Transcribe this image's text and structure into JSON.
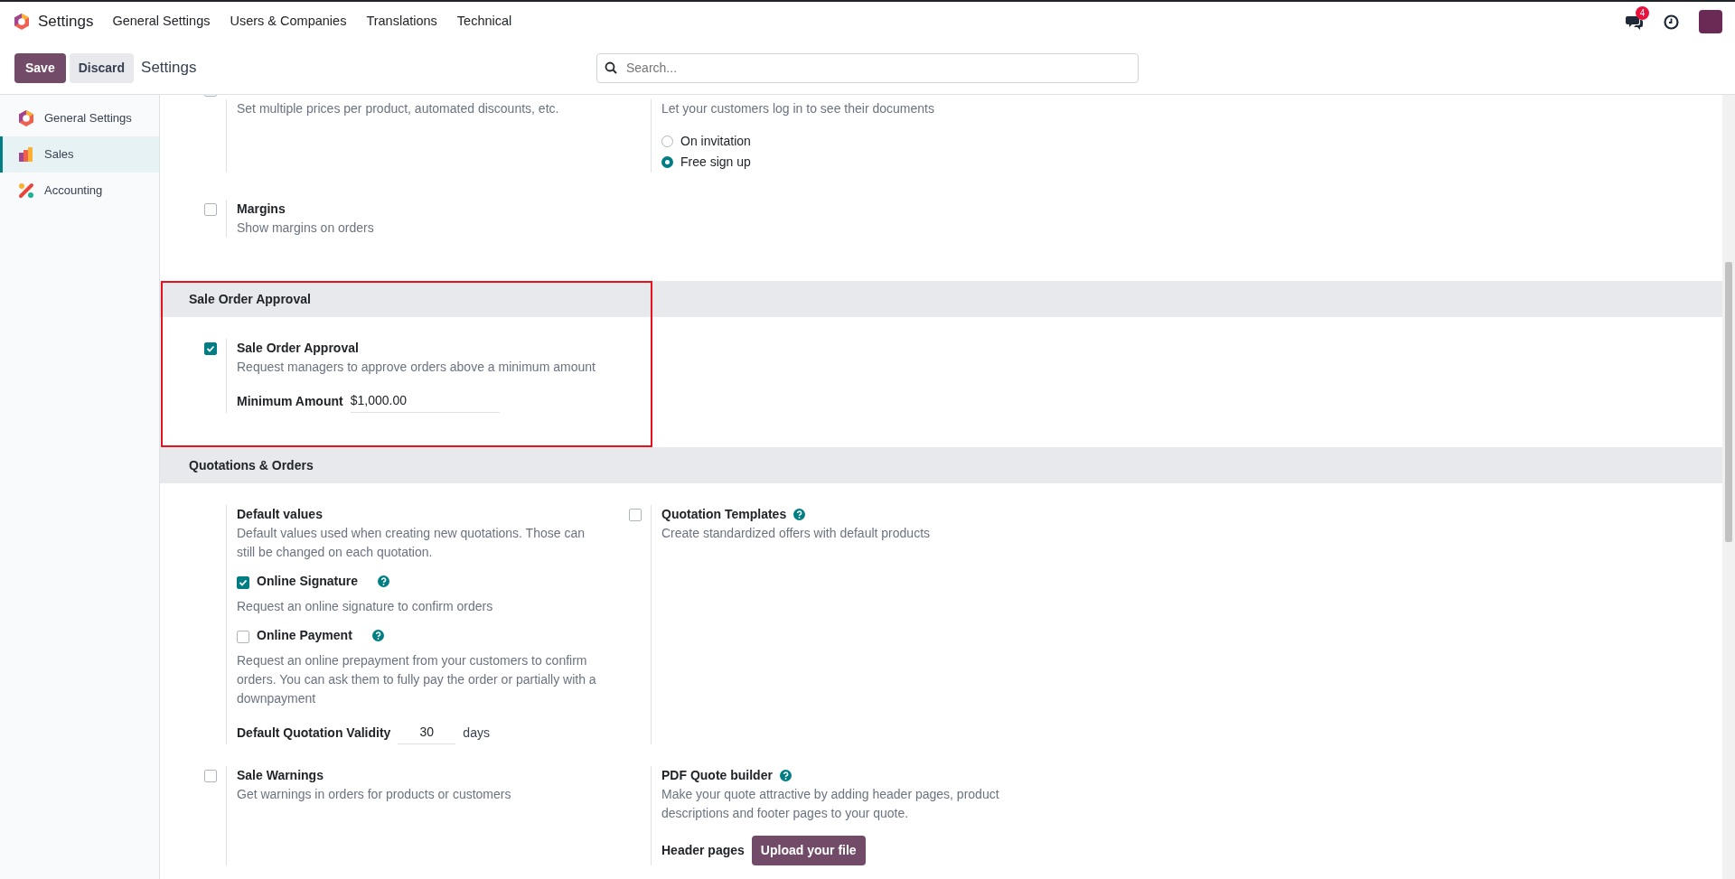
{
  "navbar": {
    "app": "Settings",
    "menu": [
      "General Settings",
      "Users & Companies",
      "Translations",
      "Technical"
    ],
    "messages_badge": "4"
  },
  "control_panel": {
    "buttons": [
      {
        "label": "Save",
        "kind": "primary"
      },
      {
        "label": "Discard",
        "kind": "secondary"
      }
    ],
    "title": "Settings",
    "search": {
      "placeholder": "Search..."
    }
  },
  "sidebar": {
    "items": [
      {
        "label": "General Settings",
        "kind": "general",
        "selected": false
      },
      {
        "label": "Sales",
        "kind": "sales",
        "selected": true
      },
      {
        "label": "Accounting",
        "kind": "accounting",
        "selected": false
      }
    ]
  },
  "sections": [
    {
      "settings": [
        {
          "kind": "checkbox",
          "checked": false,
          "description": "Set multiple prices per product, automated discounts, etc."
        },
        {
          "kind": "radio",
          "description": "Let your customers log in to see their documents",
          "options": [
            {
              "label": "On invitation",
              "selected": false
            },
            {
              "label": "Free sign up",
              "selected": true
            }
          ]
        },
        {
          "kind": "checkbox",
          "checked": false,
          "title": "Margins",
          "description": "Show margins on orders"
        }
      ]
    },
    {
      "title": "Sale Order Approval",
      "highlighted": true,
      "settings": [
        {
          "kind": "checkbox",
          "checked": true,
          "title": "Sale Order Approval",
          "description": "Request managers to approve orders above a minimum amount",
          "field": {
            "label": "Minimum Amount",
            "value": "$1,000.00"
          }
        }
      ]
    },
    {
      "title": "Quotations & Orders",
      "settings": [
        {
          "kind": "group",
          "title": "Default values",
          "description": "Default values used when creating new quotations. Those can still be changed on each quotation.",
          "options": [
            {
              "title": "Online Signature",
              "checked": true,
              "help": true,
              "description": "Request an online signature to confirm orders"
            },
            {
              "title": "Online Payment",
              "checked": false,
              "help": true,
              "description": "Request an online prepayment from your customers to confirm orders. You can ask them to fully pay the order or partially with a downpayment"
            }
          ],
          "field": {
            "label": "Default Quotation Validity",
            "value": "30",
            "suffix": "days"
          }
        },
        {
          "kind": "checkbox",
          "checked": false,
          "title": "Quotation Templates",
          "help": true,
          "description": "Create standardized offers with default products"
        },
        {
          "kind": "checkbox",
          "checked": false,
          "title": "Sale Warnings",
          "description": "Get warnings in orders for products or customers"
        },
        {
          "kind": "plain",
          "title": "PDF Quote builder",
          "help": true,
          "description": "Make your quote attractive by adding header pages, product descriptions and footer pages to your quote.",
          "field": {
            "label": "Header pages",
            "button": "Upload your file"
          }
        }
      ]
    }
  ]
}
